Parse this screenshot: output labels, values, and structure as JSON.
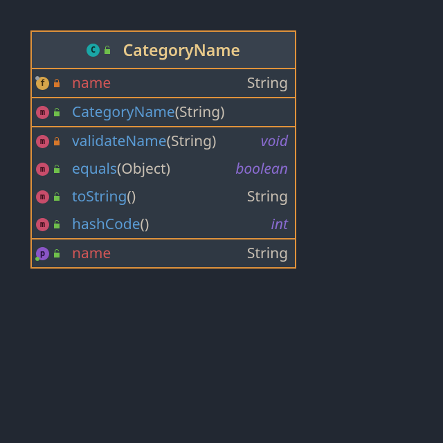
{
  "diagram": {
    "title": "CategoryName",
    "header_badge": "C",
    "header_lock": "open",
    "sections": [
      {
        "kind": "fields",
        "rows": [
          {
            "badge": "f",
            "dot": "tl",
            "lock": "closed",
            "name": "name",
            "name_color": "red",
            "type": "String",
            "type_kind": "obj"
          }
        ]
      },
      {
        "kind": "constructors",
        "rows": [
          {
            "badge": "m",
            "lock": "open",
            "name": "CategoryName",
            "params": "String",
            "type": "",
            "type_kind": "none"
          }
        ]
      },
      {
        "kind": "methods",
        "rows": [
          {
            "badge": "m",
            "lock": "closed",
            "name": "validateName",
            "params": "String",
            "type": "void",
            "type_kind": "prim"
          },
          {
            "badge": "m",
            "lock": "open",
            "name": "equals",
            "params": "Object",
            "type": "boolean",
            "type_kind": "prim"
          },
          {
            "badge": "m",
            "lock": "open",
            "name": "toString",
            "params": "",
            "type": "String",
            "type_kind": "obj"
          },
          {
            "badge": "m",
            "lock": "open",
            "name": "hashCode",
            "params": "",
            "type": "int",
            "type_kind": "prim"
          }
        ]
      },
      {
        "kind": "properties",
        "rows": [
          {
            "badge": "p",
            "dot": "bl",
            "lock": "open",
            "name": "name",
            "name_color": "red",
            "type": "String",
            "type_kind": "obj"
          }
        ]
      }
    ]
  },
  "icons": {
    "lock_open_label": "unlocked",
    "lock_closed_label": "locked"
  }
}
